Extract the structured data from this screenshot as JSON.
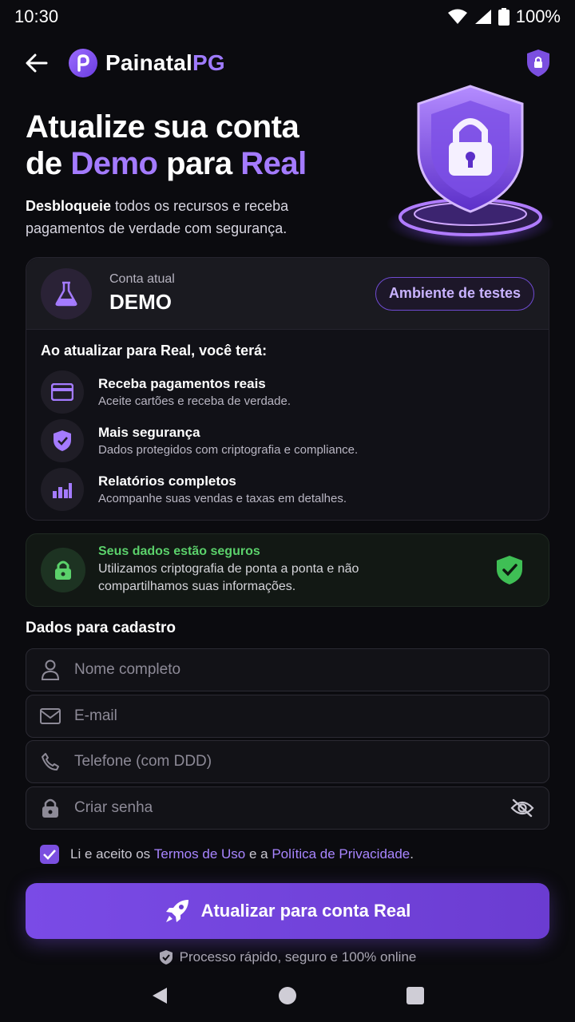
{
  "status_bar": {
    "time": "10:30",
    "battery": "100%"
  },
  "header": {
    "brand_main": "Painatal",
    "brand_accent": "PG"
  },
  "hero": {
    "title_line1": "Atualize sua conta",
    "title_de": "de",
    "title_demo": "Demo",
    "title_para": "para",
    "title_real": "Real",
    "subtitle_bold": "Desbloqueie",
    "subtitle_rest": " todos os recursos e receba pagamentos de verdade com segurança."
  },
  "account": {
    "label": "Conta atual",
    "value": "DEMO",
    "env_badge": "Ambiente de testes"
  },
  "benefits": {
    "title": "Ao atualizar para Real, você terá:",
    "items": [
      {
        "title": "Receba pagamentos reais",
        "desc": "Aceite cartões e receba de verdade.",
        "icon": "card-icon"
      },
      {
        "title": "Mais segurança",
        "desc": "Dados protegidos com criptografia e compliance.",
        "icon": "shield-check-icon"
      },
      {
        "title": "Relatórios completos",
        "desc": "Acompanhe suas vendas e taxas em detalhes.",
        "icon": "chart-icon"
      }
    ]
  },
  "security": {
    "title": "Seus dados estão seguros",
    "desc": "Utilizamos criptografia de ponta a ponta e não compartilhamos suas informações."
  },
  "form": {
    "title": "Dados para cadastro",
    "name_placeholder": "Nome completo",
    "email_placeholder": "E-mail",
    "phone_placeholder": "Telefone (com DDD)",
    "password_placeholder": "Criar senha"
  },
  "terms": {
    "prefix": "Li e aceito os ",
    "terms_link": "Termos de Uso",
    "middle": " e a ",
    "privacy_link": "Política de Privacidade",
    "suffix": ".",
    "checked": true
  },
  "cta": {
    "label": "Atualizar para conta Real"
  },
  "footnote": "Processo rápido, seguro e 100% online",
  "colors": {
    "accent": "#7b4fe0",
    "success": "#5bd16b",
    "background": "#0b0b0f"
  }
}
